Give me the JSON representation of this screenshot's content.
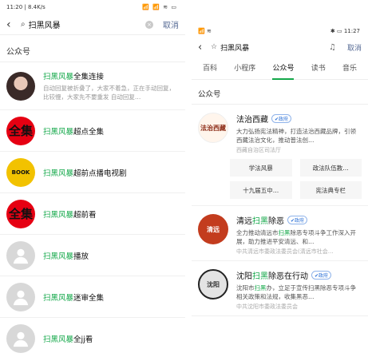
{
  "left": {
    "status": {
      "time": "11:20",
      "net": "8.4K/s",
      "right": "📶 📶 ≋ ▭"
    },
    "search": {
      "query": "扫黑风暴",
      "cancel": "取消"
    },
    "section_title": "公众号",
    "results": [
      {
        "prefix": "",
        "highlight": "扫黑风暴",
        "suffix": "全集连接",
        "desc": "自动回复被折叠了，大家不着急，正在手动回复，比较慢，大家先不要重发 自动回复…",
        "avatar_text": ""
      },
      {
        "prefix": "",
        "highlight": "扫黑风暴",
        "suffix": "超点全集",
        "desc": "",
        "avatar_text": "全集"
      },
      {
        "prefix": "",
        "highlight": "扫黑风暴",
        "suffix": "超前点播电视剧",
        "desc": "",
        "avatar_text": "BOOK"
      },
      {
        "prefix": "",
        "highlight": "扫黑风暴",
        "suffix": "超前看",
        "desc": "",
        "avatar_text": "全集"
      },
      {
        "prefix": "",
        "highlight": "扫黑风暴",
        "suffix": "播放",
        "desc": "",
        "avatar_text": ""
      },
      {
        "prefix": "",
        "highlight": "扫黑风暴",
        "suffix": "迷审全集",
        "desc": "",
        "avatar_text": ""
      },
      {
        "prefix": "",
        "highlight": "扫黑风暴",
        "suffix": "全jj看",
        "desc": "",
        "avatar_text": ""
      }
    ]
  },
  "right": {
    "status": {
      "left": "📶 ≋",
      "right": "✱ ▭ 11:27"
    },
    "search": {
      "query": "扫黑风暴",
      "cancel": "取消"
    },
    "tabs": [
      "百科",
      "小程序",
      "公众号",
      "读书",
      "音乐"
    ],
    "section_title": "公众号",
    "cards": [
      {
        "avatar_text": "法治西藏",
        "name_prefix": "法治西藏",
        "name_highlight": "",
        "name_suffix": "",
        "badge": "✔政府",
        "desc": "大力弘扬宪法精神，打造法治西藏品牌，引领西藏法治文化，推动普法创…",
        "org": "西藏自治区司法厅",
        "articles": [
          "学法风暴",
          "政法队伍教…",
          "十九届五中…",
          "宪法典专栏"
        ]
      },
      {
        "avatar_text": "清远",
        "name_prefix": "清远",
        "name_highlight": "扫黑",
        "name_suffix": "除恶",
        "badge": "✔政府",
        "desc_prefix": "全力推动清远市",
        "desc_highlight": "扫黑",
        "desc_suffix": "除恶专项斗争工作深入开展，助力推进平安清远、和…",
        "org": "中共清远市委政法委员会(清远市社会…"
      },
      {
        "avatar_text": "沈阳",
        "name_prefix": "沈阳",
        "name_highlight": "扫黑",
        "name_suffix": "除恶在行动",
        "badge": "✔政府",
        "desc_prefix": "沈阳市",
        "desc_highlight": "扫黑",
        "desc_suffix": "办，立足于宣传扫黑除恶专项斗争相关政策和法规，收集黑恶…",
        "org": "中共沈阳市委政法委员会"
      }
    ]
  }
}
